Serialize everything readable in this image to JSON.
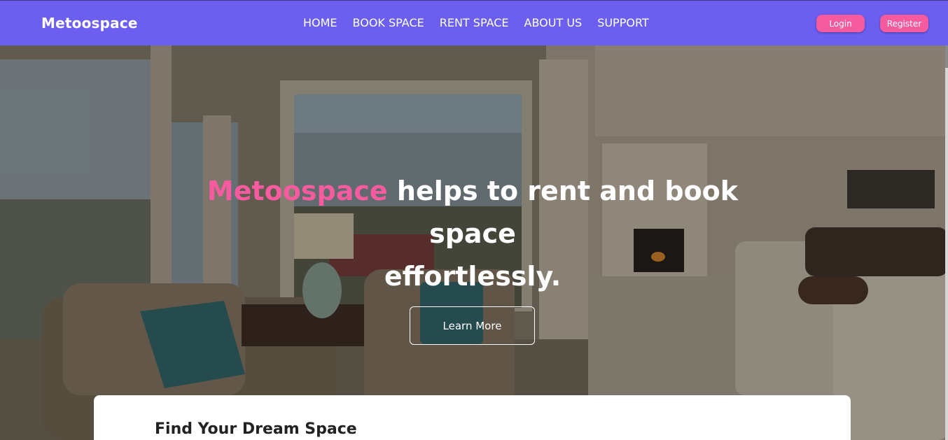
{
  "navbar": {
    "brand": "Metoospace",
    "links": [
      "HOME",
      "BOOK SPACE",
      "RENT SPACE",
      "ABOUT US",
      "SUPPORT"
    ],
    "login_label": "Login",
    "register_label": "Register",
    "background_color": "#6c5ff0",
    "accent_color": "#f55b9e"
  },
  "hero": {
    "title_accent": "Metoospace",
    "title_rest": " helps to rent and book space",
    "title_line2": "effortlessly.",
    "cta_label": "Learn More"
  },
  "search_card": {
    "title": "Find Your Dream Space"
  }
}
